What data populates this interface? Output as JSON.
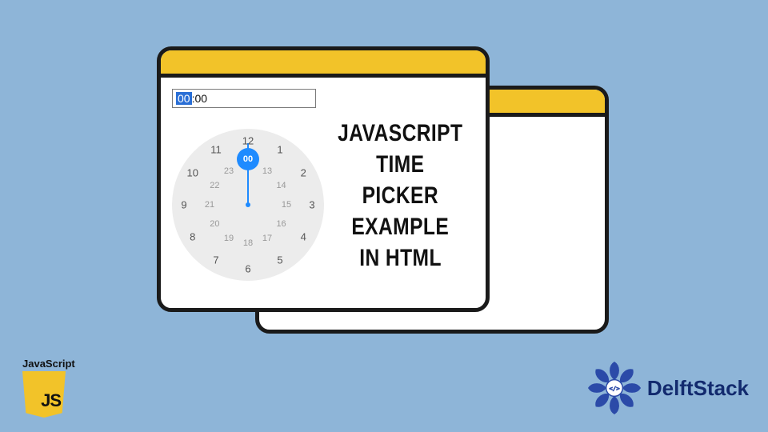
{
  "headline": {
    "line1": "JAVASCRIPT",
    "line2": "TIME PICKER",
    "line3": "EXAMPLE",
    "line4": "IN HTML"
  },
  "time_input": {
    "hours_selected": "00",
    "minutes": ":00"
  },
  "clock": {
    "knob_label": "00",
    "outer_hours": [
      "12",
      "1",
      "2",
      "3",
      "4",
      "5",
      "6",
      "7",
      "8",
      "9",
      "10",
      "11"
    ],
    "inner_hours": [
      "00",
      "13",
      "14",
      "15",
      "16",
      "17",
      "18",
      "19",
      "20",
      "21",
      "22",
      "23"
    ]
  },
  "js_badge": {
    "label": "JavaScript",
    "shield_text": "JS"
  },
  "brand": {
    "name": "DelftStack"
  },
  "colors": {
    "background": "#8eb5d8",
    "accent": "#f2c329",
    "border": "#1a1a1a",
    "primary_blue": "#1f8bff",
    "brand_blue": "#122a6e"
  }
}
